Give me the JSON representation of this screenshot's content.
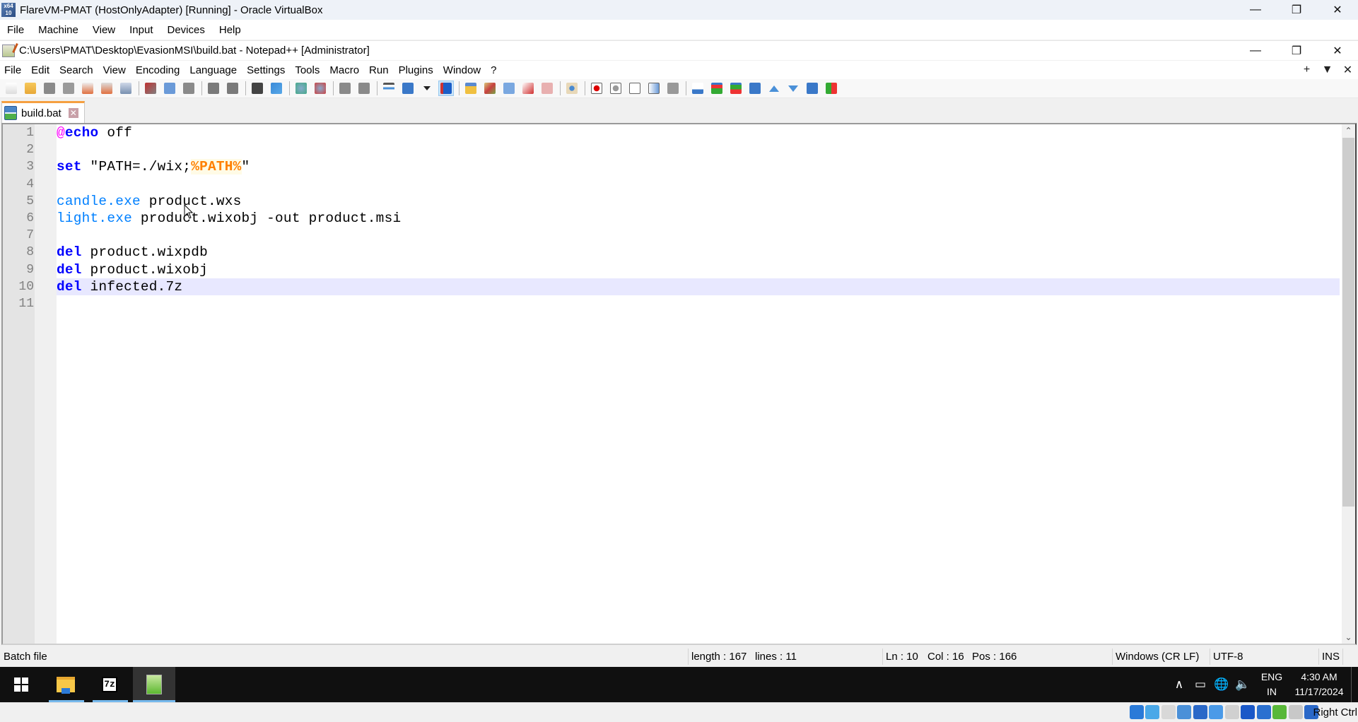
{
  "vbox": {
    "title": "FlareVM-PMAT (HostOnlyAdapter) [Running] - Oracle VirtualBox",
    "icon": "virtualbox-icon",
    "menu": [
      "File",
      "Machine",
      "View",
      "Input",
      "Devices",
      "Help"
    ],
    "window_controls": {
      "minimize": "—",
      "restore": "❐",
      "close": "✕"
    },
    "status_icons": [
      "hard-disk-icon",
      "optical-drive-icon",
      "floppy-icon",
      "audio-icon",
      "network-icon",
      "usb-icon",
      "shared-folders-icon",
      "display-icon",
      "recording-icon",
      "cpu-activity-icon",
      "mouse-integration-icon",
      "keyboard-capture-icon"
    ],
    "host_key": "Right Ctrl"
  },
  "notepad": {
    "title": "C:\\Users\\PMAT\\Desktop\\EvasionMSI\\build.bat - Notepad++ [Administrator]",
    "menu": [
      "File",
      "Edit",
      "Search",
      "View",
      "Encoding",
      "Language",
      "Settings",
      "Tools",
      "Macro",
      "Run",
      "Plugins",
      "Window",
      "?"
    ],
    "menu_right": {
      "new_tab": "+",
      "list": "▼",
      "close": "✕"
    },
    "window_controls": {
      "minimize": "—",
      "restore": "❐",
      "close": "✕"
    },
    "tab": {
      "label": "build.bat",
      "close": "✕"
    },
    "lines": [
      {
        "num": "1",
        "tokens": [
          {
            "t": "@",
            "c": "at"
          },
          {
            "t": "echo",
            "c": "kw"
          },
          {
            "t": " off",
            "c": ""
          }
        ]
      },
      {
        "num": "2",
        "tokens": []
      },
      {
        "num": "3",
        "tokens": [
          {
            "t": "set",
            "c": "kw"
          },
          {
            "t": " \"PATH=./wix;",
            "c": ""
          },
          {
            "t": "%PATH%",
            "c": "var"
          },
          {
            "t": "\"",
            "c": ""
          }
        ]
      },
      {
        "num": "4",
        "tokens": []
      },
      {
        "num": "5",
        "tokens": [
          {
            "t": "candle.exe",
            "c": "cmd"
          },
          {
            "t": " product.wxs",
            "c": ""
          }
        ]
      },
      {
        "num": "6",
        "tokens": [
          {
            "t": "light.exe",
            "c": "cmd"
          },
          {
            "t": " product.wixobj -out product.msi",
            "c": ""
          }
        ]
      },
      {
        "num": "7",
        "tokens": []
      },
      {
        "num": "8",
        "tokens": [
          {
            "t": "del",
            "c": "kw"
          },
          {
            "t": " product.wixpdb",
            "c": ""
          }
        ]
      },
      {
        "num": "9",
        "tokens": [
          {
            "t": "del",
            "c": "kw"
          },
          {
            "t": " product.wixobj",
            "c": ""
          }
        ]
      },
      {
        "num": "10",
        "tokens": [
          {
            "t": "del",
            "c": "kw"
          },
          {
            "t": " infected.7z",
            "c": ""
          }
        ],
        "current": true
      },
      {
        "num": "11",
        "tokens": []
      }
    ],
    "status": {
      "file_type": "Batch file",
      "length": "length : 167",
      "lines": "lines : 11",
      "ln": "Ln : 10",
      "col": "Col : 16",
      "pos": "Pos : 166",
      "eol": "Windows (CR LF)",
      "encoding": "UTF-8",
      "mode": "INS"
    },
    "toolbar": [
      "new-file-icon",
      "open-file-icon",
      "save-icon",
      "save-all-icon",
      "close-icon",
      "close-all-icon",
      "print-icon",
      "|",
      "cut-icon",
      "copy-icon",
      "paste-icon",
      "|",
      "undo-icon",
      "redo-icon",
      "|",
      "find-icon",
      "replace-icon",
      "|",
      "zoom-in-icon",
      "zoom-out-icon",
      "|",
      "sync-vertical-icon",
      "sync-horizontal-icon",
      "|",
      "word-wrap-icon",
      "show-all-characters-icon",
      "dropdown-arrow-icon",
      "indent-guide-icon",
      "|",
      "user-defined-language-icon",
      "document-map-icon",
      "document-list-icon",
      "function-list-icon",
      "folder-as-workspace-icon",
      "|",
      "monitoring-icon",
      "|",
      "record-macro-icon",
      "stop-recording-icon",
      "playback-macro-icon",
      "run-macro-multiple-icon",
      "save-macro-icon",
      "|",
      "change-history-icon",
      "compare-icon",
      "clear-compare-icon",
      "first-change-icon",
      "previous-change-icon",
      "next-change-icon",
      "last-change-icon",
      "document-panel-icon"
    ],
    "toolbar_active": "indent-guide-icon",
    "scroll": {
      "up": "⌃",
      "down": "⌄"
    }
  },
  "taskbar": {
    "apps": [
      {
        "name": "start-button",
        "icon": "windows-logo-icon"
      },
      {
        "name": "file-explorer",
        "icon": "folder-icon",
        "open": true
      },
      {
        "name": "7zip",
        "icon": "7zip-icon",
        "label": "7z",
        "open": true
      },
      {
        "name": "notepad-plus-plus",
        "icon": "notepad-plus-plus-icon",
        "open": true,
        "active": true
      }
    ],
    "tray": {
      "chevron": "∧",
      "battery": "▭",
      "network": "🌐",
      "volume": "🔈",
      "lang_top": "ENG",
      "lang_bottom": "IN",
      "time": "4:30 AM",
      "date": "11/17/2024"
    }
  },
  "colors": {
    "keyword": "#0000ff",
    "at_sign": "#ff00ff",
    "command": "#0080ff",
    "variable": "#ff8000",
    "current_line": "#e8e8ff",
    "tab_accent": "#f5a040"
  }
}
